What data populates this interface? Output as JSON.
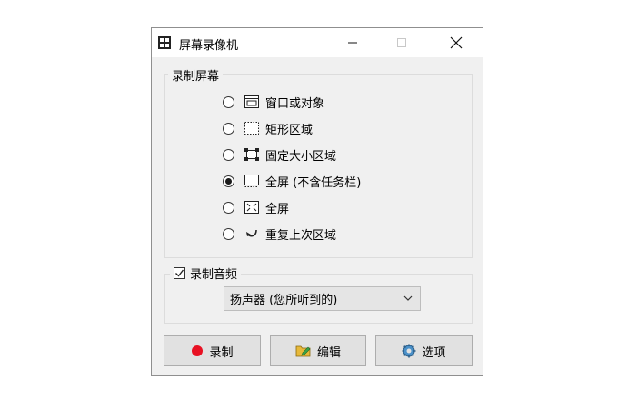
{
  "window": {
    "title": "屏幕录像机",
    "icon": "film-strip-icon"
  },
  "record_screen": {
    "legend": "录制屏幕",
    "selected": 3,
    "options": [
      {
        "label": "窗口或对象",
        "icon": "window-icon"
      },
      {
        "label": "矩形区域",
        "icon": "dotted-rect-icon"
      },
      {
        "label": "固定大小区域",
        "icon": "fixed-area-icon"
      },
      {
        "label": "全屏 (不含任务栏)",
        "icon": "fullscreen-no-taskbar-icon"
      },
      {
        "label": "全屏",
        "icon": "fullscreen-icon"
      },
      {
        "label": "重复上次区域",
        "icon": "repeat-arrow-icon"
      }
    ]
  },
  "record_audio": {
    "label": "录制音频",
    "checked": true,
    "source": "扬声器 (您所听到的)"
  },
  "buttons": {
    "record": "录制",
    "edit": "编辑",
    "options": "选项"
  },
  "colors": {
    "record_dot": "#e81123",
    "window_bg": "#f0f0f0"
  }
}
